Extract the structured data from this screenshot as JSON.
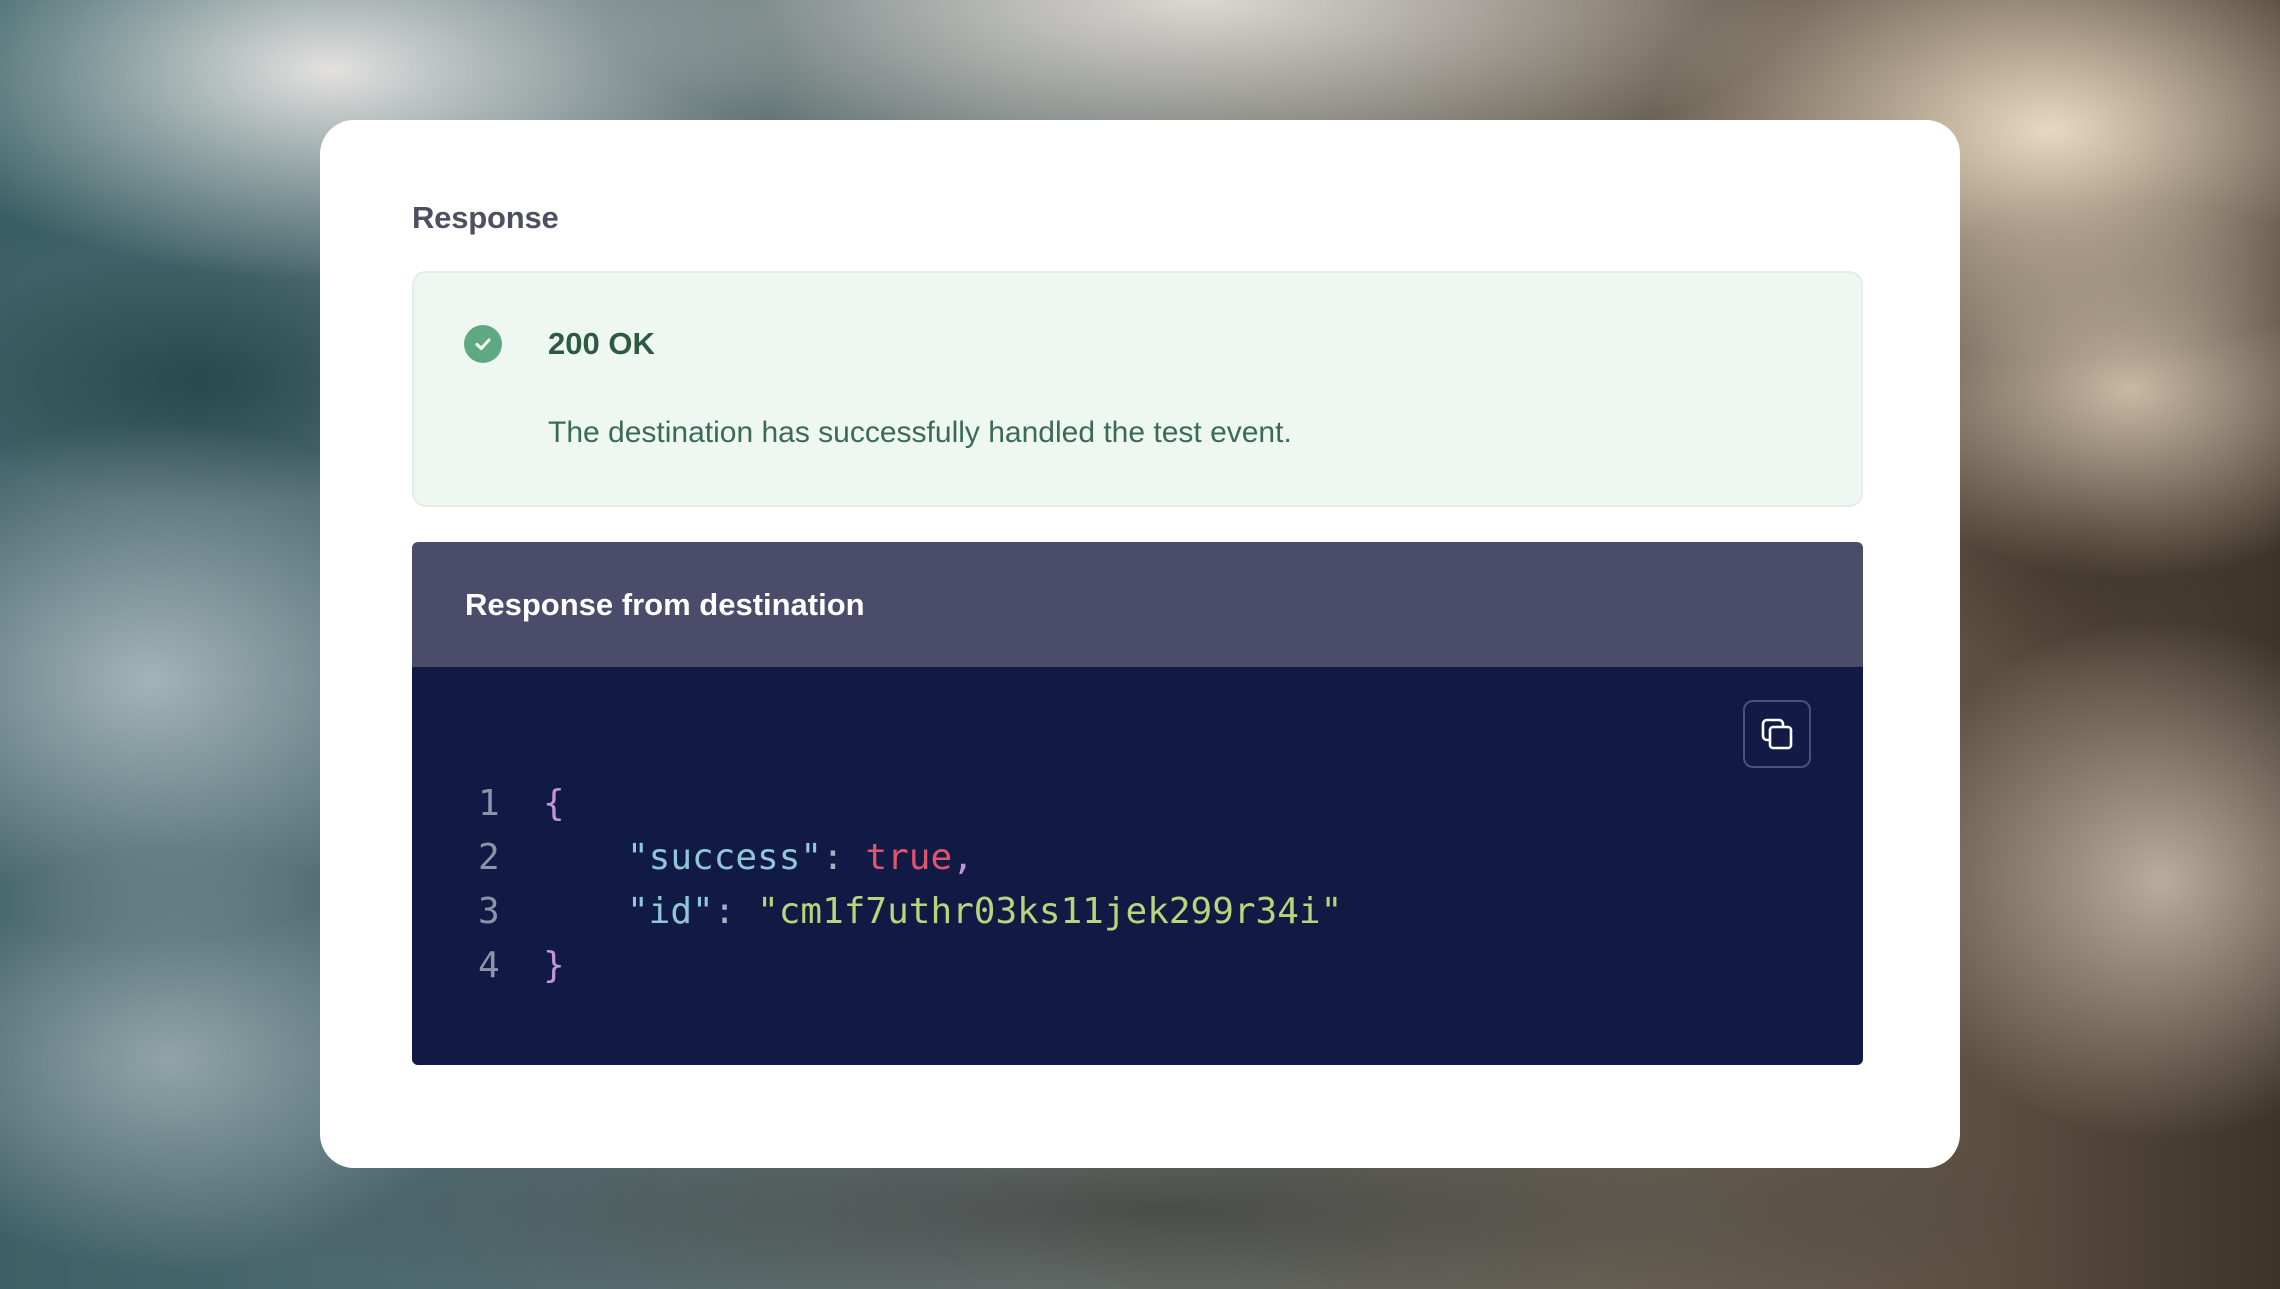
{
  "panel": {
    "title": "Response",
    "alert": {
      "icon": "check-circle-icon",
      "status": "200 OK",
      "message": "The destination has successfully handled the test event."
    },
    "code": {
      "header": "Response from destination",
      "copy_icon": "copy-icon",
      "lines": [
        {
          "number": "1",
          "open_brace": "{"
        },
        {
          "number": "2",
          "key": "\"success\"",
          "colon": ": ",
          "value": "true",
          "comma": ","
        },
        {
          "number": "3",
          "key": "\"id\"",
          "colon": ": ",
          "value": "\"cm1f7uthr03ks11jek299r34i\""
        },
        {
          "number": "4",
          "close_brace": "}"
        }
      ]
    }
  },
  "colors": {
    "success_green": "#5ea883",
    "code_header_bg": "#4b4c6a",
    "code_bg": "#111a44",
    "boolean": "#e0546e",
    "string": "#b6d67a",
    "key": "#8fc7d8",
    "brace": "#c593d8"
  }
}
